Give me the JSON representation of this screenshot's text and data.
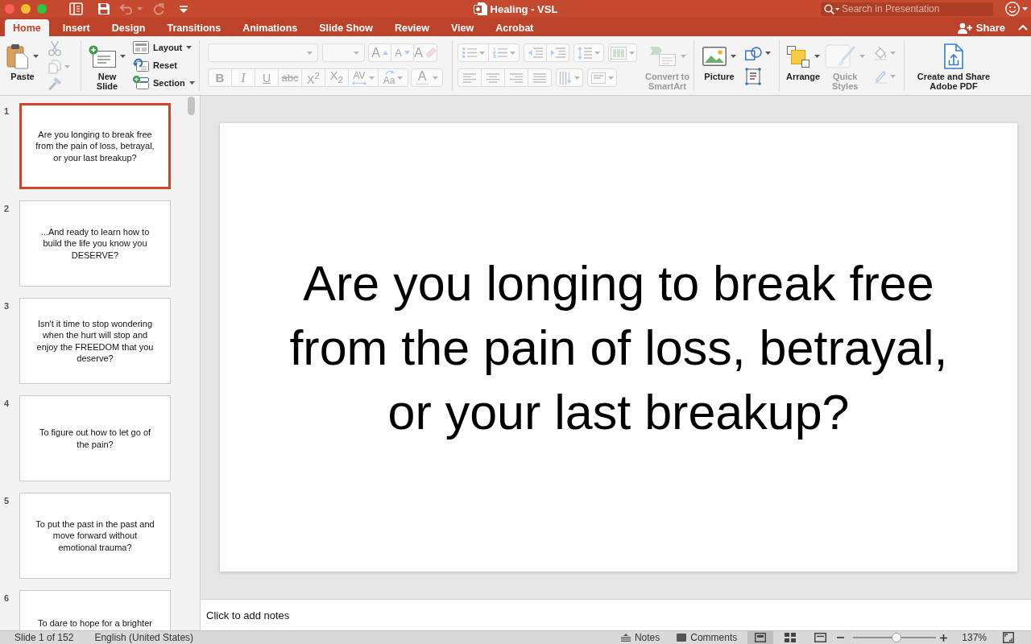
{
  "window": {
    "title": "Healing - VSL",
    "search": {
      "placeholder": "Search in Presentation"
    }
  },
  "quick_access": [
    {
      "kind": "sidebar",
      "disabled": false
    },
    {
      "kind": "save",
      "disabled": false
    },
    {
      "kind": "undo",
      "disabled": true
    },
    {
      "kind": "redo",
      "disabled": true
    },
    {
      "kind": "customize",
      "disabled": false
    }
  ],
  "tabs": [
    {
      "label": "Home",
      "selected": true
    },
    {
      "label": "Insert",
      "selected": false
    },
    {
      "label": "Design",
      "selected": false
    },
    {
      "label": "Transitions",
      "selected": false
    },
    {
      "label": "Animations",
      "selected": false
    },
    {
      "label": "Slide Show",
      "selected": false
    },
    {
      "label": "Review",
      "selected": false
    },
    {
      "label": "View",
      "selected": false
    },
    {
      "label": "Acrobat",
      "selected": false
    }
  ],
  "share": {
    "label": "Share"
  },
  "ribbon": {
    "clipboard": {
      "paste": {
        "label": "Paste",
        "disabled": false
      },
      "tools": [
        {
          "kind": "cut",
          "disabled": true
        },
        {
          "kind": "copy",
          "disabled": true
        },
        {
          "kind": "format_painter",
          "disabled": true
        }
      ]
    },
    "slides": {
      "new_slide": {
        "label": "New Slide",
        "disabled": false
      },
      "commands": [
        {
          "kind": "layout",
          "label": "Layout",
          "disabled": false
        },
        {
          "kind": "reset",
          "label": "Reset",
          "disabled": false
        },
        {
          "kind": "section",
          "label": "Section",
          "disabled": false
        }
      ]
    },
    "font": {
      "font_name": {
        "disabled": true
      },
      "font_size": {
        "disabled": true
      },
      "size_buttons": [
        {
          "kind": "grow_font",
          "label": "A",
          "disabled": true
        },
        {
          "kind": "shrink_font",
          "label": "A",
          "disabled": true
        }
      ],
      "clear_formatting": {
        "label": "A",
        "disabled": true
      },
      "format_buttons": [
        {
          "kind": "bold",
          "label": "B",
          "disabled": true
        },
        {
          "kind": "italic",
          "label": "I",
          "disabled": true
        },
        {
          "kind": "underline",
          "label": "U",
          "disabled": true
        },
        {
          "kind": "strikethrough",
          "label": "abc",
          "disabled": true
        },
        {
          "kind": "superscript",
          "label": "X$^{2}$",
          "disabled": true
        },
        {
          "kind": "subscript",
          "label": "X$_{2}$",
          "disabled": true
        },
        {
          "kind": "character_spacing",
          "label": "AV",
          "disabled": true
        },
        {
          "kind": "change_case",
          "label": "Aa",
          "disabled": true
        }
      ],
      "font_color": {
        "label": "A",
        "disabled": true
      }
    },
    "paragraph": {
      "row_1": [
        {
          "kind": "bullets",
          "disabled": true
        },
        {
          "kind": "numbering",
          "disabled": true
        },
        {
          "kind": "decrease_indent",
          "disabled": true
        },
        {
          "kind": "increase_indent",
          "disabled": true
        },
        {
          "kind": "line_spacing",
          "disabled": true
        },
        {
          "kind": "columns",
          "disabled": true
        }
      ],
      "row_2": [
        {
          "kind": "align_left",
          "disabled": true
        },
        {
          "kind": "align_center",
          "disabled": true
        },
        {
          "kind": "align_right",
          "disabled": true
        },
        {
          "kind": "justify",
          "disabled": true
        },
        {
          "kind": "text_direction",
          "disabled": true
        },
        {
          "kind": "align_text",
          "disabled": true
        }
      ],
      "smartart": {
        "label": "Convert to SmartArt",
        "disabled": true
      }
    },
    "insert": {
      "picture": {
        "label": "Picture",
        "disabled": false
      },
      "tools": [
        {
          "kind": "shapes",
          "disabled": false
        },
        {
          "kind": "text_box",
          "disabled": false
        }
      ]
    },
    "drawing": {
      "arrange": {
        "label": "Arrange",
        "disabled": false
      },
      "quick_styles": {
        "label": "Quick Styles",
        "disabled": true
      },
      "tools": [
        {
          "kind": "fill",
          "disabled": true
        },
        {
          "kind": "outline",
          "disabled": true
        }
      ]
    },
    "pdf": {
      "label": "Create and Share Adobe PDF",
      "disabled": false
    }
  },
  "slides": [
    {
      "number": "1",
      "text": "Are you longing to break free from the pain of loss, betrayal, or your last breakup?",
      "selected": true
    },
    {
      "number": "2",
      "text": "...And ready to learn how to build the life you know you DESERVE?",
      "selected": false
    },
    {
      "number": "3",
      "text": "Isn't it time to stop wondering when the hurt will stop and enjoy the FREEDOM that you deserve?",
      "selected": false
    },
    {
      "number": "4",
      "text": "To figure out how to let go of the pain?",
      "selected": false
    },
    {
      "number": "5",
      "text": "To put the past in the past and move forward without emotional trauma?",
      "selected": false
    },
    {
      "number": "6",
      "text": "To dare to hope for a brighter",
      "selected": false
    }
  ],
  "slide_canvas": {
    "text": "Are you longing to break free from the pain of loss, betrayal, or your last breakup?"
  },
  "notes": {
    "placeholder": "Click to add notes"
  },
  "status_bar": {
    "slide_info": "Slide 1 of 152",
    "language": "English (United States)",
    "notes_label": "Notes",
    "comments_label": "Comments",
    "views": [
      {
        "kind": "normal",
        "selected": true
      },
      {
        "kind": "sorter",
        "selected": false
      },
      {
        "kind": "reading",
        "selected": false
      }
    ],
    "zoom": {
      "level": 0.52,
      "reading": "137%"
    }
  }
}
